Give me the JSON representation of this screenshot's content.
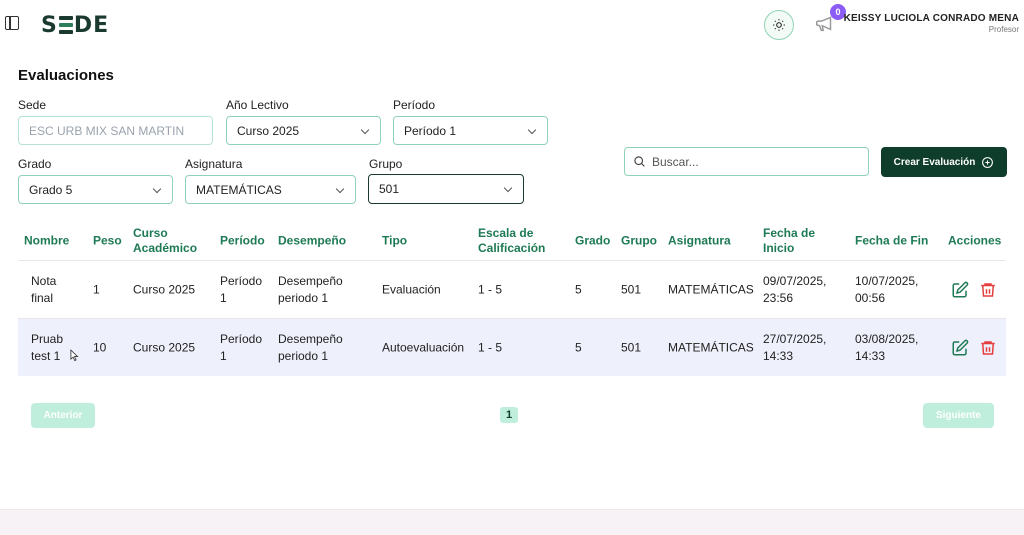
{
  "header": {
    "logo_text": "SEDE",
    "notification_count": "0",
    "user_name": "KEISSY LUCIOLA CONRADO MENA",
    "user_role": "Profesor"
  },
  "page": {
    "title": "Evaluaciones"
  },
  "filters": {
    "sede": {
      "label": "Sede",
      "value": "ESC URB MIX SAN MARTIN"
    },
    "anio": {
      "label": "Año Lectivo",
      "value": "Curso 2025"
    },
    "periodo": {
      "label": "Período",
      "value": "Período 1"
    },
    "grado": {
      "label": "Grado",
      "value": "Grado 5"
    },
    "asignatura": {
      "label": "Asignatura",
      "value": "MATEMÁTICAS"
    },
    "grupo": {
      "label": "Grupo",
      "value": "501"
    }
  },
  "search": {
    "placeholder": "Buscar..."
  },
  "create_button": "Crear Evaluación",
  "table": {
    "headers": {
      "nombre": "Nombre",
      "peso": "Peso",
      "curso_1": "Curso",
      "curso_2": "Académico",
      "periodo": "Período",
      "desempeno": "Desempeño",
      "tipo": "Tipo",
      "escala_1": "Escala de",
      "escala_2": "Calificación",
      "grado": "Grado",
      "grupo": "Grupo",
      "asignatura": "Asignatura",
      "inicio_1": "Fecha de",
      "inicio_2": "Inicio",
      "fin": "Fecha de Fin",
      "acciones": "Acciones"
    },
    "rows": [
      {
        "nombre_1": "Nota",
        "nombre_2": "final",
        "peso": "1",
        "curso": "Curso 2025",
        "periodo_1": "Período",
        "periodo_2": "1",
        "desempeno_1": "Desempeño",
        "desempeno_2": "periodo 1",
        "tipo": "Evaluación",
        "escala": "1 - 5",
        "grado": "5",
        "grupo": "501",
        "asignatura": "MATEMÁTICAS",
        "inicio_1": "09/07/2025,",
        "inicio_2": "23:56",
        "fin_1": "10/07/2025,",
        "fin_2": "00:56"
      },
      {
        "nombre_1": "Pruab",
        "nombre_2": "test 1",
        "peso": "10",
        "curso": "Curso 2025",
        "periodo_1": "Período",
        "periodo_2": "1",
        "desempeno_1": "Desempeño",
        "desempeno_2": "periodo 1",
        "tipo": "Autoevaluación",
        "escala": "1 - 5",
        "grado": "5",
        "grupo": "501",
        "asignatura": "MATEMÁTICAS",
        "inicio_1": "27/07/2025,",
        "inicio_2": "14:33",
        "fin_1": "03/08/2025,",
        "fin_2": "14:33"
      }
    ]
  },
  "pagination": {
    "prev": "Anterior",
    "page": "1",
    "next": "Siguiente"
  }
}
